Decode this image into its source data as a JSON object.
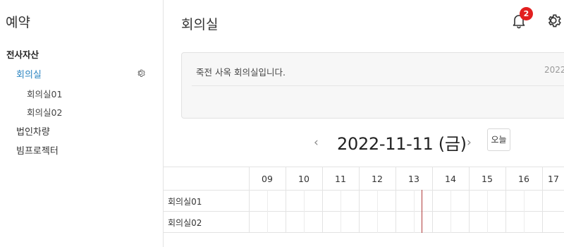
{
  "sidebar": {
    "title": "예약",
    "group": "전사자산",
    "items": [
      {
        "label": "회의실",
        "active": true
      },
      {
        "label": "회의실01"
      },
      {
        "label": "회의실02"
      },
      {
        "label": "법인차량"
      },
      {
        "label": "빔프로젝터"
      }
    ]
  },
  "header": {
    "title": "회의실",
    "notification_count": "2"
  },
  "notice": {
    "text": "죽전 사옥 회의실입니다.",
    "date": "2022-"
  },
  "date_nav": {
    "date": "2022-11-11 (금)",
    "today_label": "오늘"
  },
  "timeline": {
    "hours": [
      "09",
      "10",
      "11",
      "12",
      "13",
      "14",
      "15",
      "16",
      "17"
    ],
    "rooms": [
      "회의실01",
      "회의실02"
    ],
    "current_time_marker_hour": "13:30"
  },
  "colors": {
    "accent": "#2e86c1",
    "badge": "#e21f1f",
    "now_line": "#b03a3a"
  }
}
